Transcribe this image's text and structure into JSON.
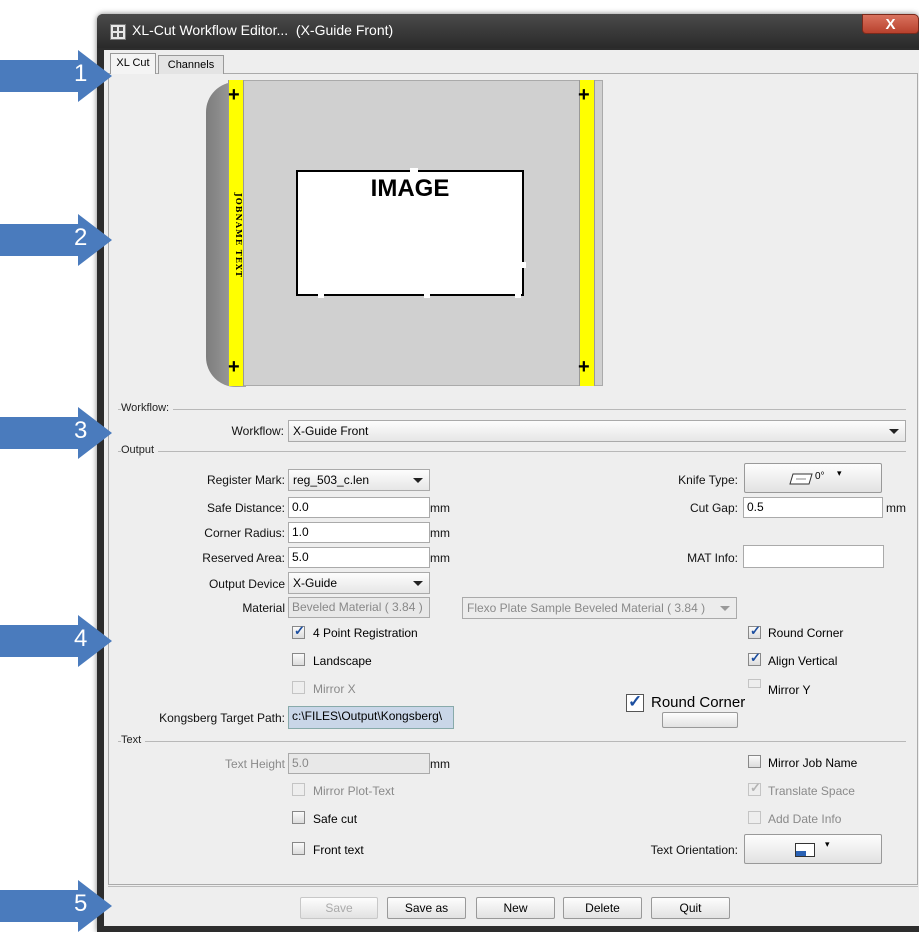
{
  "window": {
    "title": "XL-Cut Workflow Editor...  (X-Guide Front)",
    "close_label": "X"
  },
  "tabs": [
    {
      "label": "XL Cut",
      "active": true
    },
    {
      "label": "Channels",
      "active": false
    }
  ],
  "callouts": [
    "1",
    "2",
    "3",
    "4",
    "5"
  ],
  "callout_color": "#4a7bbd",
  "preview": {
    "image_label": "IMAGE",
    "jobname_text": "JOBNAME TEXT",
    "mark_color": "#ffff00"
  },
  "workflow_section": {
    "header": "Workflow:",
    "workflow_label": "Workflow:",
    "workflow_value": "X-Guide Front"
  },
  "output_section": {
    "header": "Output",
    "register_mark_label": "Register Mark:",
    "register_mark_value": "reg_503_c.len",
    "safe_distance_label": "Safe Distance:",
    "safe_distance_value": "0.0",
    "corner_radius_label": "Corner Radius:",
    "corner_radius_value": "1.0",
    "reserved_area_label": "Reserved Area:",
    "reserved_area_value": "5.0",
    "unit_mm": "mm",
    "output_device_label": "Output Device",
    "output_device_value": "X-Guide",
    "material_label": "Material",
    "material_value": "Beveled Material ( 3.84 )",
    "material_profile_value": "Flexo Plate Sample Beveled Material ( 3.84 )",
    "knife_type_label": "Knife Type:",
    "knife_angle": "0°",
    "cut_gap_label": "Cut Gap:",
    "cut_gap_value": "0.5",
    "mat_info_label": "MAT Info:",
    "mat_info_value": "",
    "four_point_label": "4 Point Registration",
    "four_point_checked": true,
    "landscape_label": "Landscape",
    "landscape_checked": false,
    "mirror_x_label": "Mirror X",
    "round_corner_label": "Round Corner",
    "round_corner_checked": true,
    "align_vertical_label": "Align Vertical",
    "align_vertical_checked": true,
    "mirror_y_label": "Mirror Y",
    "kongsberg_label": "Kongsberg Target Path:",
    "kongsberg_value": "c:\\FILES\\Output\\Kongsberg\\",
    "overlay_round_corner_label": "Round Corner"
  },
  "text_section": {
    "header": "Text",
    "text_height_label": "Text Height",
    "text_height_value": "5.0",
    "unit_mm": "mm",
    "mirror_plot_text_label": "Mirror Plot-Text",
    "safe_cut_label": "Safe cut",
    "front_text_label": "Front text",
    "mirror_job_name_label": "Mirror Job Name",
    "translate_space_label": "Translate Space",
    "translate_space_checked": true,
    "add_date_info_label": "Add Date Info",
    "text_orientation_label": "Text Orientation:"
  },
  "buttons": {
    "save": "Save",
    "save_as": "Save as",
    "new": "New",
    "delete": "Delete",
    "quit": "Quit"
  }
}
